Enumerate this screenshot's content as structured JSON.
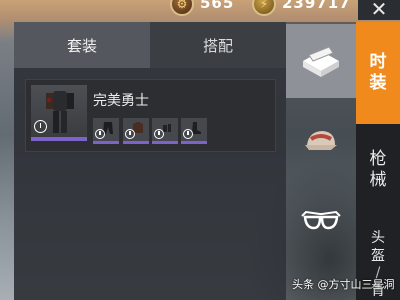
{
  "currency": [
    {
      "icon": "bp-coin-icon",
      "glyph": "⚙",
      "value": "565"
    },
    {
      "icon": "uc-coin-icon",
      "glyph": "⚡",
      "value": "239717"
    }
  ],
  "close_label": "✕",
  "tabs": [
    {
      "label": "套装",
      "active": true
    },
    {
      "label": "搭配",
      "active": false
    }
  ],
  "item": {
    "name": "完美勇士",
    "pieces": 4
  },
  "categories": [
    {
      "icon": "outfit-crate-icon",
      "active": true
    },
    {
      "icon": "cap-icon",
      "active": false
    },
    {
      "icon": "glasses-icon",
      "active": false
    }
  ],
  "side_tabs": [
    {
      "label_lines": [
        "时",
        "装"
      ],
      "active": true
    },
    {
      "label_lines": [
        "枪",
        "械"
      ],
      "active": false
    },
    {
      "label_lines": [
        "头",
        "盔",
        "/",
        "背"
      ],
      "active": false
    }
  ],
  "watermark": "头条 @方寸山三星洞",
  "colors": {
    "accent": "#f08a1c",
    "rarity": "#7b63c9"
  }
}
